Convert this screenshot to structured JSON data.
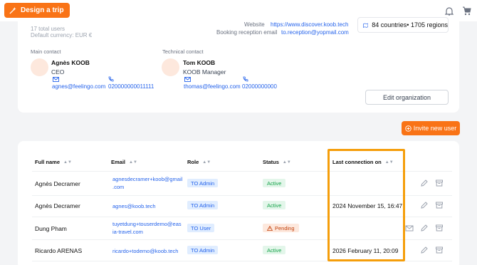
{
  "topbar": {
    "design_label": "Design a trip",
    "icons": [
      "magic-wand-icon",
      "bell-icon",
      "cart-icon"
    ]
  },
  "org": {
    "total_users": "17 total users",
    "default_currency": "Default currency: EUR €",
    "website_label": "Website",
    "website_value": "https://www.discover.koob.tech",
    "booking_email_label": "Booking reception email",
    "booking_email_value": "to.reception@yopmail.com",
    "coverage": "84 countries• 1705 regions",
    "edit_label": "Edit organization"
  },
  "contacts": {
    "main": {
      "label": "Main contact",
      "name": "Agnès KOOB",
      "role": "CEO",
      "email": "agnes@feelingo.com",
      "phone": "020000000011111"
    },
    "technical": {
      "label": "Technical contact",
      "name": "Tom KOOB",
      "role": "KOOB Manager",
      "email": "thomas@feelingo.com",
      "phone": "02000000000"
    }
  },
  "invite_label": "Invite new user",
  "table": {
    "headers": {
      "full_name": "Full name",
      "email": "Email",
      "role": "Role",
      "status": "Status",
      "last_connection": "Last connection on"
    },
    "rows": [
      {
        "name": "Agnès Decramer",
        "email_line1": "agnesdecramer+koob@gmail",
        "email_line2": ".com",
        "role": "TO Admin",
        "status": "Active",
        "last_connection": ""
      },
      {
        "name": "Agnès Decramer",
        "email_line1": "agnes@koob.tech",
        "email_line2": "",
        "role": "TO Admin",
        "status": "Active",
        "last_connection": "2024 November 15, 16:47"
      },
      {
        "name": "Dung Pham",
        "email_line1": "tuyetdung+touserdemo@eas",
        "email_line2": "ia-travel.com",
        "role": "TO User",
        "status": "Pending",
        "last_connection": ""
      },
      {
        "name": "Ricardo ARENAS",
        "email_line1": "ricardo+todemo@koob.tech",
        "email_line2": "",
        "role": "TO Admin",
        "status": "Active",
        "last_connection": "2026 February 11, 20:09"
      }
    ]
  },
  "colors": {
    "accent": "#f97316",
    "link": "#2563eb",
    "highlight": "#f59e0b"
  }
}
